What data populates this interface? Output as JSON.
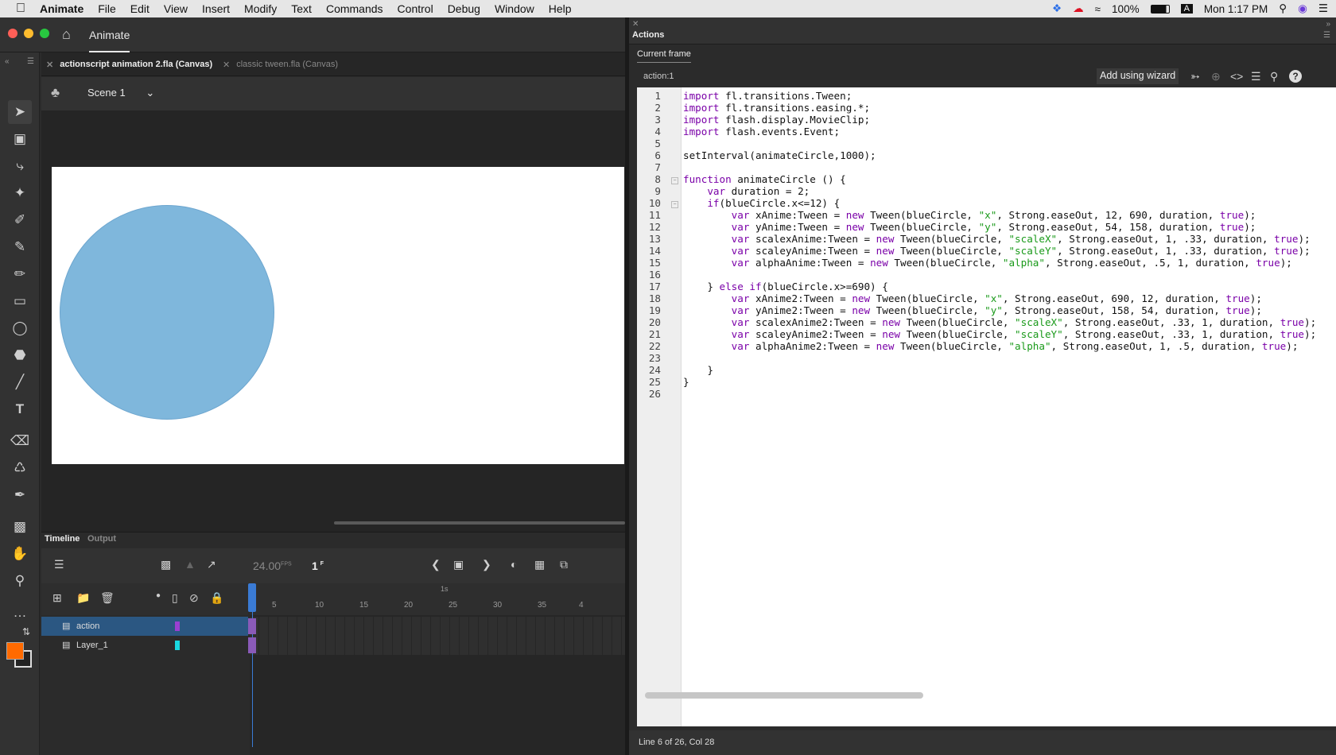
{
  "menubar": {
    "app_name": "Animate",
    "items": [
      "File",
      "Edit",
      "View",
      "Insert",
      "Modify",
      "Text",
      "Commands",
      "Control",
      "Debug",
      "Window",
      "Help"
    ],
    "battery": "100%",
    "input_badge": "A",
    "clock": "Mon 1:17 PM"
  },
  "app": {
    "tab_label": "Animate",
    "doc_tabs": [
      {
        "label": "actionscript animation 2.fla (Canvas)",
        "active": true
      },
      {
        "label": "classic tween.fla (Canvas)",
        "active": false
      }
    ],
    "scene": "Scene 1",
    "stage_color": "#ffffff",
    "circle_color": "#7fb7dc"
  },
  "timeline": {
    "tabs": [
      "Timeline",
      "Output"
    ],
    "fps": "24.00",
    "fps_unit": "FPS",
    "frame": "1",
    "frame_unit": "F",
    "ruler_second": "1s",
    "ruler_marks": [
      "5",
      "10",
      "15",
      "20",
      "25",
      "30",
      "35",
      "4"
    ],
    "layers": [
      {
        "name": "action",
        "color": "#9a3fd1",
        "selected": true
      },
      {
        "name": "Layer_1",
        "color": "#19d8e0",
        "selected": false
      }
    ]
  },
  "actions": {
    "panel_title": "Actions",
    "current_frame_label": "Current frame",
    "frame_name": "action:1",
    "wizard_label": "Add using wizard",
    "status": "Line 6 of 26, Col 28",
    "code_lines": [
      [
        [
          "k",
          "import"
        ],
        [
          "t",
          " fl.transitions.Tween;"
        ]
      ],
      [
        [
          "k",
          "import"
        ],
        [
          "t",
          " fl.transitions.easing.*;"
        ]
      ],
      [
        [
          "k",
          "import"
        ],
        [
          "t",
          " flash.display.MovieClip;"
        ]
      ],
      [
        [
          "k",
          "import"
        ],
        [
          "t",
          " flash.events.Event;"
        ]
      ],
      [],
      [
        [
          "t",
          "setInterval(animateCircle,1000);"
        ]
      ],
      [],
      [
        [
          "k",
          "function"
        ],
        [
          "t",
          " animateCircle () {"
        ]
      ],
      [
        [
          "t",
          "    "
        ],
        [
          "k",
          "var"
        ],
        [
          "t",
          " duration = 2;"
        ]
      ],
      [
        [
          "t",
          "    "
        ],
        [
          "k",
          "if"
        ],
        [
          "t",
          "(blueCircle.x<=12) {"
        ]
      ],
      [
        [
          "t",
          "        "
        ],
        [
          "k",
          "var"
        ],
        [
          "t",
          " xAnime:Tween = "
        ],
        [
          "k",
          "new"
        ],
        [
          "t",
          " Tween(blueCircle, "
        ],
        [
          "s",
          "\"x\""
        ],
        [
          "t",
          ", Strong.easeOut, 12, 690, duration, "
        ],
        [
          "k",
          "true"
        ],
        [
          "t",
          ");"
        ]
      ],
      [
        [
          "t",
          "        "
        ],
        [
          "k",
          "var"
        ],
        [
          "t",
          " yAnime:Tween = "
        ],
        [
          "k",
          "new"
        ],
        [
          "t",
          " Tween(blueCircle, "
        ],
        [
          "s",
          "\"y\""
        ],
        [
          "t",
          ", Strong.easeOut, 54, 158, duration, "
        ],
        [
          "k",
          "true"
        ],
        [
          "t",
          ");"
        ]
      ],
      [
        [
          "t",
          "        "
        ],
        [
          "k",
          "var"
        ],
        [
          "t",
          " scalexAnime:Tween = "
        ],
        [
          "k",
          "new"
        ],
        [
          "t",
          " Tween(blueCircle, "
        ],
        [
          "s",
          "\"scaleX\""
        ],
        [
          "t",
          ", Strong.easeOut, 1, .33, duration, "
        ],
        [
          "k",
          "true"
        ],
        [
          "t",
          ");"
        ]
      ],
      [
        [
          "t",
          "        "
        ],
        [
          "k",
          "var"
        ],
        [
          "t",
          " scaleyAnime:Tween = "
        ],
        [
          "k",
          "new"
        ],
        [
          "t",
          " Tween(blueCircle, "
        ],
        [
          "s",
          "\"scaleY\""
        ],
        [
          "t",
          ", Strong.easeOut, 1, .33, duration, "
        ],
        [
          "k",
          "true"
        ],
        [
          "t",
          ");"
        ]
      ],
      [
        [
          "t",
          "        "
        ],
        [
          "k",
          "var"
        ],
        [
          "t",
          " alphaAnime:Tween = "
        ],
        [
          "k",
          "new"
        ],
        [
          "t",
          " Tween(blueCircle, "
        ],
        [
          "s",
          "\"alpha\""
        ],
        [
          "t",
          ", Strong.easeOut, .5, 1, duration, "
        ],
        [
          "k",
          "true"
        ],
        [
          "t",
          ");"
        ]
      ],
      [],
      [
        [
          "t",
          "    } "
        ],
        [
          "k",
          "else if"
        ],
        [
          "t",
          "(blueCircle.x>=690) {"
        ]
      ],
      [
        [
          "t",
          "        "
        ],
        [
          "k",
          "var"
        ],
        [
          "t",
          " xAnime2:Tween = "
        ],
        [
          "k",
          "new"
        ],
        [
          "t",
          " Tween(blueCircle, "
        ],
        [
          "s",
          "\"x\""
        ],
        [
          "t",
          ", Strong.easeOut, 690, 12, duration, "
        ],
        [
          "k",
          "true"
        ],
        [
          "t",
          ");"
        ]
      ],
      [
        [
          "t",
          "        "
        ],
        [
          "k",
          "var"
        ],
        [
          "t",
          " yAnime2:Tween = "
        ],
        [
          "k",
          "new"
        ],
        [
          "t",
          " Tween(blueCircle, "
        ],
        [
          "s",
          "\"y\""
        ],
        [
          "t",
          ", Strong.easeOut, 158, 54, duration, "
        ],
        [
          "k",
          "true"
        ],
        [
          "t",
          ");"
        ]
      ],
      [
        [
          "t",
          "        "
        ],
        [
          "k",
          "var"
        ],
        [
          "t",
          " scalexAnime2:Tween = "
        ],
        [
          "k",
          "new"
        ],
        [
          "t",
          " Tween(blueCircle, "
        ],
        [
          "s",
          "\"scaleX\""
        ],
        [
          "t",
          ", Strong.easeOut, .33, 1, duration, "
        ],
        [
          "k",
          "true"
        ],
        [
          "t",
          ");"
        ]
      ],
      [
        [
          "t",
          "        "
        ],
        [
          "k",
          "var"
        ],
        [
          "t",
          " scaleyAnime2:Tween = "
        ],
        [
          "k",
          "new"
        ],
        [
          "t",
          " Tween(blueCircle, "
        ],
        [
          "s",
          "\"scaleY\""
        ],
        [
          "t",
          ", Strong.easeOut, .33, 1, duration, "
        ],
        [
          "k",
          "true"
        ],
        [
          "t",
          ");"
        ]
      ],
      [
        [
          "t",
          "        "
        ],
        [
          "k",
          "var"
        ],
        [
          "t",
          " alphaAnime2:Tween = "
        ],
        [
          "k",
          "new"
        ],
        [
          "t",
          " Tween(blueCircle, "
        ],
        [
          "s",
          "\"alpha\""
        ],
        [
          "t",
          ", Strong.easeOut, 1, .5, duration, "
        ],
        [
          "k",
          "true"
        ],
        [
          "t",
          ");"
        ]
      ],
      [],
      [
        [
          "t",
          "    }"
        ]
      ],
      [
        [
          "t",
          "}"
        ]
      ],
      []
    ]
  },
  "icons": {
    "apple": "apple-icon",
    "home": "home-icon",
    "select": "selection-tool-icon",
    "text_tool": "text-tool-icon"
  }
}
